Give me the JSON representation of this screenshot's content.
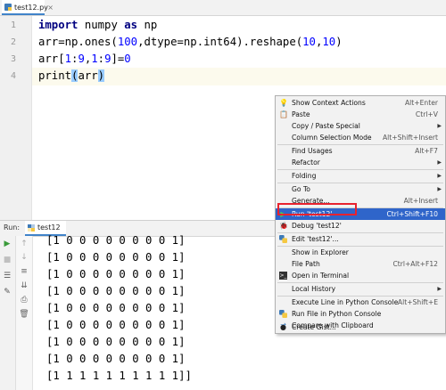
{
  "editor_tab": {
    "label": "test12.py"
  },
  "code": {
    "line_numbers": [
      "1",
      "2",
      "3",
      "4"
    ],
    "line1": [
      "import",
      " numpy ",
      "as",
      " np"
    ],
    "line2": [
      "arr=np.ones(",
      "100",
      ",dtype=np.int64).reshape(",
      "10",
      ",",
      "10",
      ")"
    ],
    "line3": [
      "arr[",
      "1",
      ":",
      "9",
      ",",
      "1",
      ":",
      "9",
      "]=",
      "0"
    ],
    "line4": [
      "print",
      "(",
      "arr",
      ")"
    ]
  },
  "run_panel": {
    "label": "Run:",
    "tab": "test12",
    "output": [
      "[1 0 0 0 0 0 0 0 0 1]",
      "[1 0 0 0 0 0 0 0 0 1]",
      "[1 0 0 0 0 0 0 0 0 1]",
      "[1 0 0 0 0 0 0 0 0 1]",
      "[1 0 0 0 0 0 0 0 0 1]",
      "[1 0 0 0 0 0 0 0 0 1]",
      "[1 0 0 0 0 0 0 0 0 1]",
      "[1 0 0 0 0 0 0 0 0 1]",
      "[1 1 1 1 1 1 1 1 1 1]]"
    ]
  },
  "context_menu": {
    "items": [
      {
        "label": "Show Context Actions",
        "shortcut": "Alt+Enter",
        "icon": "bulb-icon"
      },
      {
        "label": "Paste",
        "shortcut": "Ctrl+V",
        "icon": "paste-icon"
      },
      {
        "label": "Copy / Paste Special",
        "shortcut": "",
        "submenu": true
      },
      {
        "label": "Column Selection Mode",
        "shortcut": "Alt+Shift+Insert"
      },
      {
        "label": "Find Usages",
        "shortcut": "Alt+F7"
      },
      {
        "label": "Refactor",
        "shortcut": "",
        "submenu": true
      },
      {
        "label": "Folding",
        "shortcut": "",
        "submenu": true
      },
      {
        "label": "Go To",
        "shortcut": "",
        "submenu": true
      },
      {
        "label": "Generate...",
        "shortcut": "Alt+Insert"
      },
      {
        "label": "Run 'test12'",
        "shortcut": "Ctrl+Shift+F10",
        "icon": "run-icon",
        "selected": true
      },
      {
        "label": "Debug 'test12'",
        "shortcut": "",
        "icon": "debug-icon"
      },
      {
        "label": "Edit 'test12'...",
        "shortcut": "",
        "icon": "python-icon"
      },
      {
        "label": "Show in Explorer",
        "shortcut": ""
      },
      {
        "label": "File Path",
        "shortcut": "Ctrl+Alt+F12"
      },
      {
        "label": "Open in Terminal",
        "shortcut": "",
        "icon": "terminal-icon"
      },
      {
        "label": "Local History",
        "shortcut": "",
        "submenu": true
      },
      {
        "label": "Execute Line in Python Console",
        "shortcut": "Alt+Shift+E"
      },
      {
        "label": "Run File in Python Console",
        "shortcut": "",
        "icon": "python-console-icon"
      },
      {
        "label": "Compare with Clipboard",
        "shortcut": "",
        "icon": "compare-icon"
      },
      {
        "label": "Create Gist...",
        "shortcut": "",
        "icon": "github-icon"
      }
    ]
  },
  "colors": {
    "accent": "#2f65ca",
    "highlight_box": "#e8222e",
    "keyword": "#000080",
    "number": "#0000ff"
  }
}
